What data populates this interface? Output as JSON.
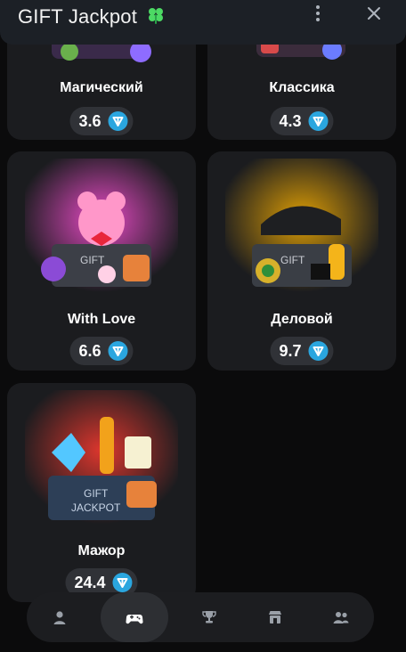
{
  "header": {
    "title": "GIFT Jackpot"
  },
  "cases": [
    {
      "name": "Магический",
      "price": "3.6"
    },
    {
      "name": "Классика",
      "price": "4.3"
    },
    {
      "name": "With Love",
      "price": "6.6"
    },
    {
      "name": "Деловой",
      "price": "9.7"
    },
    {
      "name": "Мажор",
      "price": "24.4"
    }
  ],
  "nav": {
    "items": [
      "profile-icon",
      "gamepad-icon",
      "trophy-icon",
      "shop-icon",
      "users-icon"
    ],
    "active": "gamepad-icon"
  },
  "colors": {
    "accent": "#2aa6df",
    "card": "#1b1c1f",
    "pill": "#303237"
  }
}
